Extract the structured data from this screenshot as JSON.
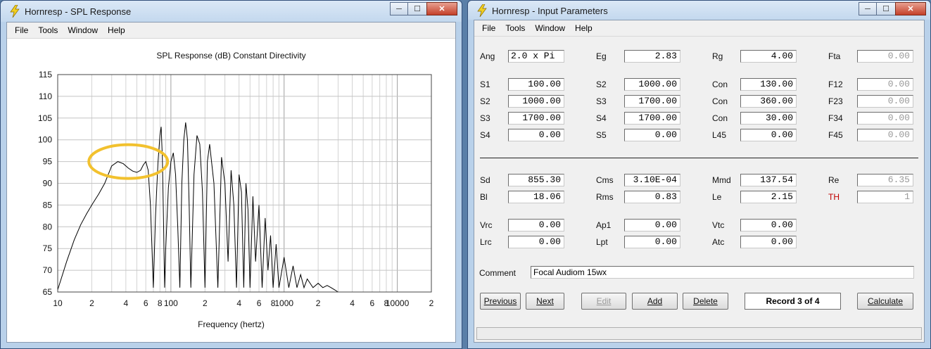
{
  "spl_window": {
    "title": "Hornresp - SPL Response",
    "menu": [
      "File",
      "Tools",
      "Window",
      "Help"
    ],
    "graph_title": "SPL Response (dB)   Constant Directivity",
    "xlabel": "Frequency (hertz)",
    "annotation_color": "#f2c12e"
  },
  "input_window": {
    "title": "Hornresp - Input Parameters",
    "menu": [
      "File",
      "Tools",
      "Window",
      "Help"
    ],
    "rows1": [
      [
        {
          "l": "Ang",
          "v": "2.0 x Pi"
        },
        {
          "l": "Eg",
          "v": "2.83"
        },
        {
          "l": "Rg",
          "v": "4.00"
        },
        {
          "l": "Fta",
          "v": "0.00"
        }
      ],
      [
        {
          "l": "S1",
          "v": "100.00"
        },
        {
          "l": "S2",
          "v": "1000.00"
        },
        {
          "l": "Con",
          "v": "130.00"
        },
        {
          "l": "F12",
          "v": "0.00"
        }
      ],
      [
        {
          "l": "S2",
          "v": "1000.00"
        },
        {
          "l": "S3",
          "v": "1700.00"
        },
        {
          "l": "Con",
          "v": "360.00"
        },
        {
          "l": "F23",
          "v": "0.00"
        }
      ],
      [
        {
          "l": "S3",
          "v": "1700.00"
        },
        {
          "l": "S4",
          "v": "1700.00"
        },
        {
          "l": "Con",
          "v": "30.00"
        },
        {
          "l": "F34",
          "v": "0.00"
        }
      ],
      [
        {
          "l": "S4",
          "v": "0.00"
        },
        {
          "l": "S5",
          "v": "0.00"
        },
        {
          "l": "L45",
          "v": "0.00"
        },
        {
          "l": "F45",
          "v": "0.00"
        }
      ]
    ],
    "rows2": [
      [
        {
          "l": "Sd",
          "v": "855.30"
        },
        {
          "l": "Cms",
          "v": "3.10E-04"
        },
        {
          "l": "Mmd",
          "v": "137.54"
        },
        {
          "l": "Re",
          "v": "6.35"
        }
      ],
      [
        {
          "l": "Bl",
          "v": "18.06"
        },
        {
          "l": "Rms",
          "v": "0.83"
        },
        {
          "l": "Le",
          "v": "2.15"
        },
        {
          "l": "TH",
          "v": "1"
        }
      ]
    ],
    "rows3": [
      [
        {
          "l": "Vrc",
          "v": "0.00"
        },
        {
          "l": "Ap1",
          "v": "0.00"
        },
        {
          "l": "Vtc",
          "v": "0.00"
        }
      ],
      [
        {
          "l": "Lrc",
          "v": "0.00"
        },
        {
          "l": "Lpt",
          "v": "0.00"
        },
        {
          "l": "Atc",
          "v": "0.00"
        }
      ]
    ],
    "comment_label": "Comment",
    "comment": "Focal Audiom 15wx",
    "buttons": {
      "previous": "Previous",
      "next": "Next",
      "edit": "Edit",
      "add": "Add",
      "delete": "Delete",
      "record": "Record 3 of 4",
      "calculate": "Calculate"
    }
  },
  "chart_data": {
    "type": "line",
    "title": "SPL Response (dB)   Constant Directivity",
    "xlabel": "Frequency (hertz)",
    "ylabel": "",
    "x_scale": "log",
    "xlim": [
      10,
      20000
    ],
    "ylim": [
      65,
      115
    ],
    "yticks": [
      65,
      70,
      75,
      80,
      85,
      90,
      95,
      100,
      105,
      110,
      115
    ],
    "xtick_labels": [
      "10",
      "2",
      "4",
      "6",
      "8",
      "100",
      "2",
      "4",
      "6",
      "8",
      "1000",
      "2",
      "4",
      "6",
      "8",
      "10000",
      "2"
    ],
    "xtick_values": [
      10,
      20,
      40,
      60,
      80,
      100,
      200,
      400,
      600,
      800,
      1000,
      2000,
      4000,
      6000,
      8000,
      10000,
      20000
    ],
    "grid": true,
    "series": [
      {
        "x": [
          10,
          12,
          14,
          16,
          18,
          20,
          23,
          26,
          30,
          34,
          38,
          42,
          46,
          50,
          54,
          57,
          60,
          63,
          66,
          70,
          73,
          75,
          77,
          80,
          82,
          84,
          86,
          88,
          90,
          95,
          100,
          105,
          110,
          115,
          120,
          125,
          130,
          135,
          140,
          145,
          150,
          160,
          170,
          180,
          190,
          200,
          210,
          220,
          240,
          260,
          280,
          300,
          320,
          340,
          360,
          380,
          400,
          420,
          440,
          460,
          480,
          500,
          530,
          560,
          600,
          640,
          680,
          720,
          760,
          800,
          850,
          900,
          1000,
          1100,
          1200,
          1300,
          1400,
          1500,
          1600,
          1800,
          2000,
          2200,
          2400,
          2600,
          2800,
          3000
        ],
        "y": [
          65.5,
          72,
          77,
          80.5,
          83,
          85,
          87.5,
          90,
          94,
          95,
          94.5,
          93.5,
          92.8,
          92.5,
          93,
          94.2,
          95,
          93,
          85,
          66,
          82,
          89,
          95,
          101,
          103,
          96,
          82,
          66,
          75,
          89,
          95,
          97,
          92,
          80,
          66,
          90,
          100,
          104,
          100,
          85,
          66,
          92,
          101,
          99,
          88,
          66,
          95,
          99,
          90,
          66,
          96,
          90,
          72,
          93,
          85,
          66,
          92,
          88,
          66,
          90,
          84,
          66,
          87,
          72,
          85,
          66,
          82,
          70,
          78,
          66,
          76,
          66,
          73,
          66,
          71,
          66,
          69,
          66,
          68,
          66,
          67,
          66,
          66.5,
          66,
          65.5,
          65
        ]
      }
    ]
  }
}
